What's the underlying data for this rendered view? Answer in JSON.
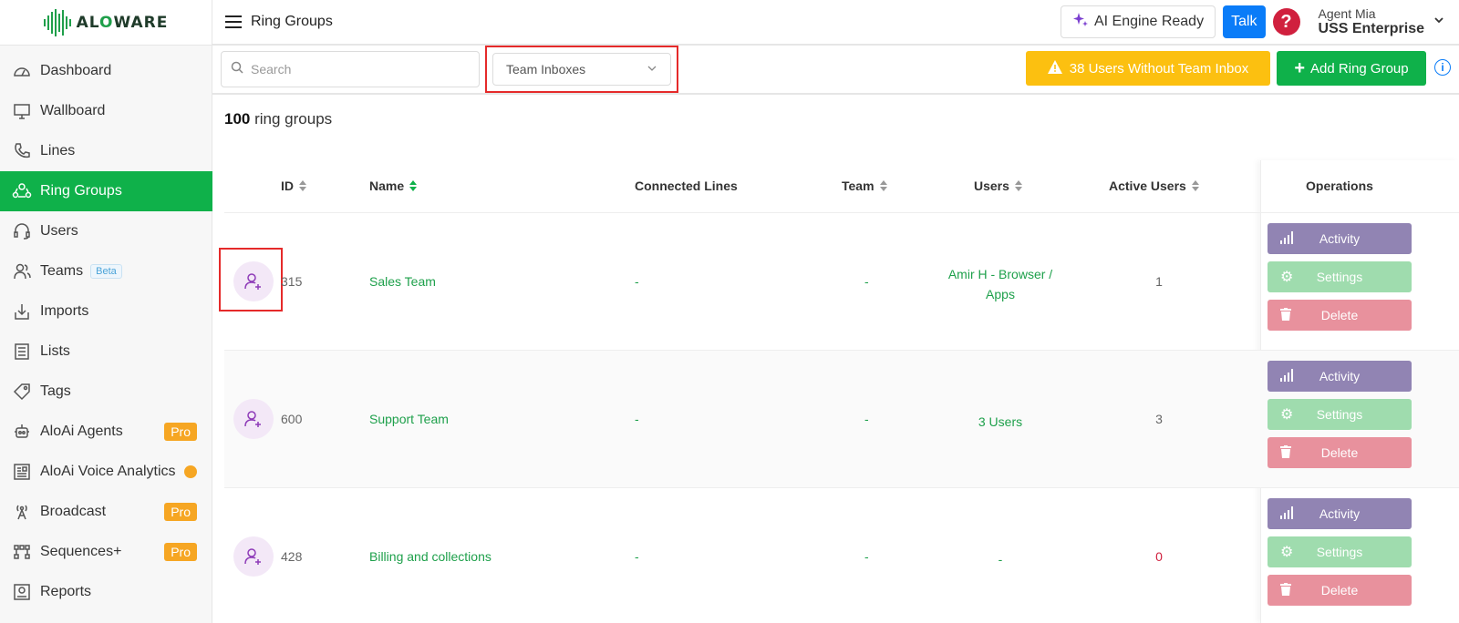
{
  "brand": {
    "logo_text_a": "AL",
    "logo_text_accent": "O",
    "logo_text_b": "WARE"
  },
  "sidebar": {
    "items": [
      {
        "label": "Dashboard",
        "icon": "dashboard-icon"
      },
      {
        "label": "Wallboard",
        "icon": "monitor-icon"
      },
      {
        "label": "Lines",
        "icon": "phone-icon"
      },
      {
        "label": "Ring Groups",
        "icon": "ring-groups-icon",
        "active": true
      },
      {
        "label": "Users",
        "icon": "headset-icon"
      },
      {
        "label": "Teams",
        "icon": "team-icon",
        "badge": "Beta"
      },
      {
        "label": "Imports",
        "icon": "import-icon"
      },
      {
        "label": "Lists",
        "icon": "list-icon"
      },
      {
        "label": "Tags",
        "icon": "tag-icon"
      },
      {
        "label": "AloAi Agents",
        "icon": "robot-icon",
        "badge": "Pro"
      },
      {
        "label": "AloAi Voice Analytics",
        "icon": "analytics-icon",
        "dot": true
      },
      {
        "label": "Broadcast",
        "icon": "broadcast-icon",
        "badge": "Pro"
      },
      {
        "label": "Sequences+",
        "icon": "sequence-icon",
        "badge": "Pro"
      },
      {
        "label": "Reports",
        "icon": "report-icon"
      }
    ]
  },
  "topbar": {
    "title": "Ring Groups",
    "ai_engine": "AI Engine Ready",
    "talk": "Talk",
    "help": "?",
    "agent_name": "Agent Mia",
    "agent_company": "USS Enterprise"
  },
  "toolbar": {
    "search_placeholder": "Search",
    "select_value": "Team Inboxes",
    "warning": "38 Users Without Team Inbox",
    "add": "Add Ring Group",
    "info": "i"
  },
  "summary": {
    "count": "100",
    "label": "ring groups"
  },
  "table": {
    "headers": {
      "id": "ID",
      "name": "Name",
      "lines": "Connected Lines",
      "team": "Team",
      "users": "Users",
      "active": "Active Users",
      "ops": "Operations"
    },
    "rows": [
      {
        "id": "315",
        "name": "Sales Team",
        "lines": "-",
        "team": "-",
        "users": "Amir H - Browser / Apps",
        "active": "1"
      },
      {
        "id": "600",
        "name": "Support Team",
        "lines": "-",
        "team": "-",
        "users": "3 Users",
        "active": "3"
      },
      {
        "id": "428",
        "name": "Billing and collections",
        "lines": "-",
        "team": "-",
        "users": "-",
        "active": "0"
      }
    ],
    "ops": {
      "activity": "Activity",
      "settings": "Settings",
      "delete": "Delete"
    }
  },
  "colors": {
    "brand_green": "#0fb14a",
    "warning_yellow": "#fcc010",
    "talk_blue": "#0a7cf8",
    "help_red": "#d0203e",
    "highlight_red": "#e52a2a"
  }
}
